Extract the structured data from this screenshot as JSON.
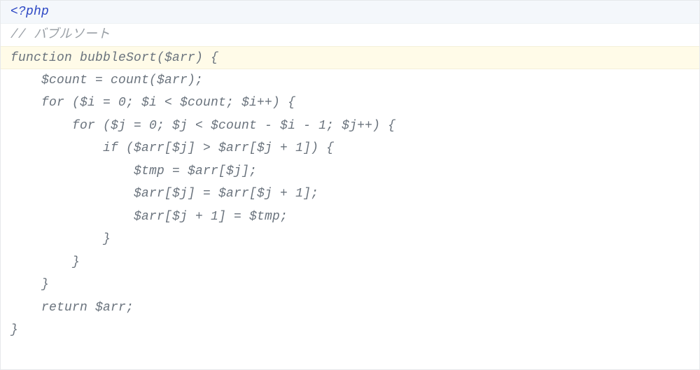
{
  "code": {
    "lines": [
      {
        "kind": "first",
        "segments": [
          {
            "cls": "tk-tag",
            "text": "<?php"
          }
        ]
      },
      {
        "kind": "normal",
        "segments": [
          {
            "cls": "tk-comment",
            "text": "// バブルソート"
          }
        ]
      },
      {
        "kind": "hl",
        "segments": [
          {
            "cls": "tk-code",
            "text": "function bubbleSort($arr) {"
          }
        ]
      },
      {
        "kind": "normal",
        "segments": [
          {
            "cls": "tk-code",
            "text": "    $count = count($arr);"
          }
        ]
      },
      {
        "kind": "normal",
        "segments": [
          {
            "cls": "tk-code",
            "text": "    for ($i = 0; $i < $count; $i++) {"
          }
        ]
      },
      {
        "kind": "normal",
        "segments": [
          {
            "cls": "tk-code",
            "text": "        for ($j = 0; $j < $count - $i - 1; $j++) {"
          }
        ]
      },
      {
        "kind": "normal",
        "segments": [
          {
            "cls": "tk-code",
            "text": "            if ($arr[$j] > $arr[$j + 1]) {"
          }
        ]
      },
      {
        "kind": "normal",
        "segments": [
          {
            "cls": "tk-code",
            "text": "                $tmp = $arr[$j];"
          }
        ]
      },
      {
        "kind": "normal",
        "segments": [
          {
            "cls": "tk-code",
            "text": "                $arr[$j] = $arr[$j + 1];"
          }
        ]
      },
      {
        "kind": "normal",
        "segments": [
          {
            "cls": "tk-code",
            "text": "                $arr[$j + 1] = $tmp;"
          }
        ]
      },
      {
        "kind": "normal",
        "segments": [
          {
            "cls": "tk-code",
            "text": "            }"
          }
        ]
      },
      {
        "kind": "normal",
        "segments": [
          {
            "cls": "tk-code",
            "text": "        }"
          }
        ]
      },
      {
        "kind": "normal",
        "segments": [
          {
            "cls": "tk-code",
            "text": "    }"
          }
        ]
      },
      {
        "kind": "normal",
        "segments": [
          {
            "cls": "tk-code",
            "text": "    return $arr;"
          }
        ]
      },
      {
        "kind": "normal",
        "segments": [
          {
            "cls": "tk-code",
            "text": "}"
          }
        ]
      }
    ]
  }
}
